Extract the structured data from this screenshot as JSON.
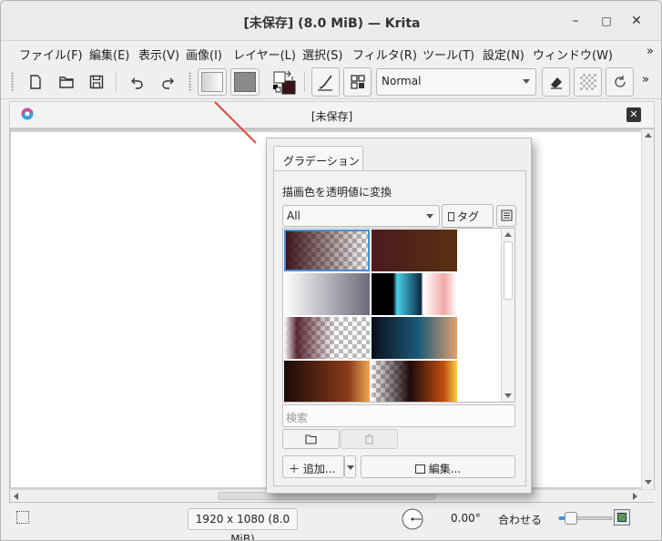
{
  "window": {
    "title": "[未保存]  (8.0 MiB)  — Krita",
    "minimize_glyph": "–",
    "maximize_glyph": "□",
    "close_glyph": "✕"
  },
  "menubar": {
    "items": [
      "ファイル(F)",
      "編集(E)",
      "表示(V)",
      "画像(I)",
      "レイヤー(L)",
      "選択(S)",
      "フィルタ(R)",
      "ツール(T)",
      "設定(N)",
      "ウィンドウ(W)"
    ],
    "more": "»"
  },
  "toolbar": {
    "blend_mode": "Normal",
    "more": "»",
    "icons": [
      "new-document-icon",
      "open-folder-icon",
      "save-icon",
      "undo-icon",
      "redo-icon",
      "gradient-swatch-icon",
      "pattern-swatch-icon",
      "color-swap-icon",
      "brush-preset-icon",
      "brush-presets-grid-icon",
      "eraser-icon",
      "alpha-lock-icon",
      "reload-preset-icon"
    ],
    "colors": {
      "foreground": "#3a1218",
      "background": "#ffffff"
    }
  },
  "document_tab": {
    "title": "[未保存]",
    "close_glyph": "✕"
  },
  "gradient_popup": {
    "tab_label": "グラデーション",
    "selected_name": "描画色を透明値に変換",
    "filter_value": "All",
    "tag_label": "タグ",
    "search_placeholder": "検索",
    "add_label": "＋ 追加...",
    "edit_label": "編集..."
  },
  "statusbar": {
    "canvas_size": "1920 x 1080 (8.0 MiB)",
    "rotation": "0.00°",
    "zoom_label": "合わせる"
  }
}
